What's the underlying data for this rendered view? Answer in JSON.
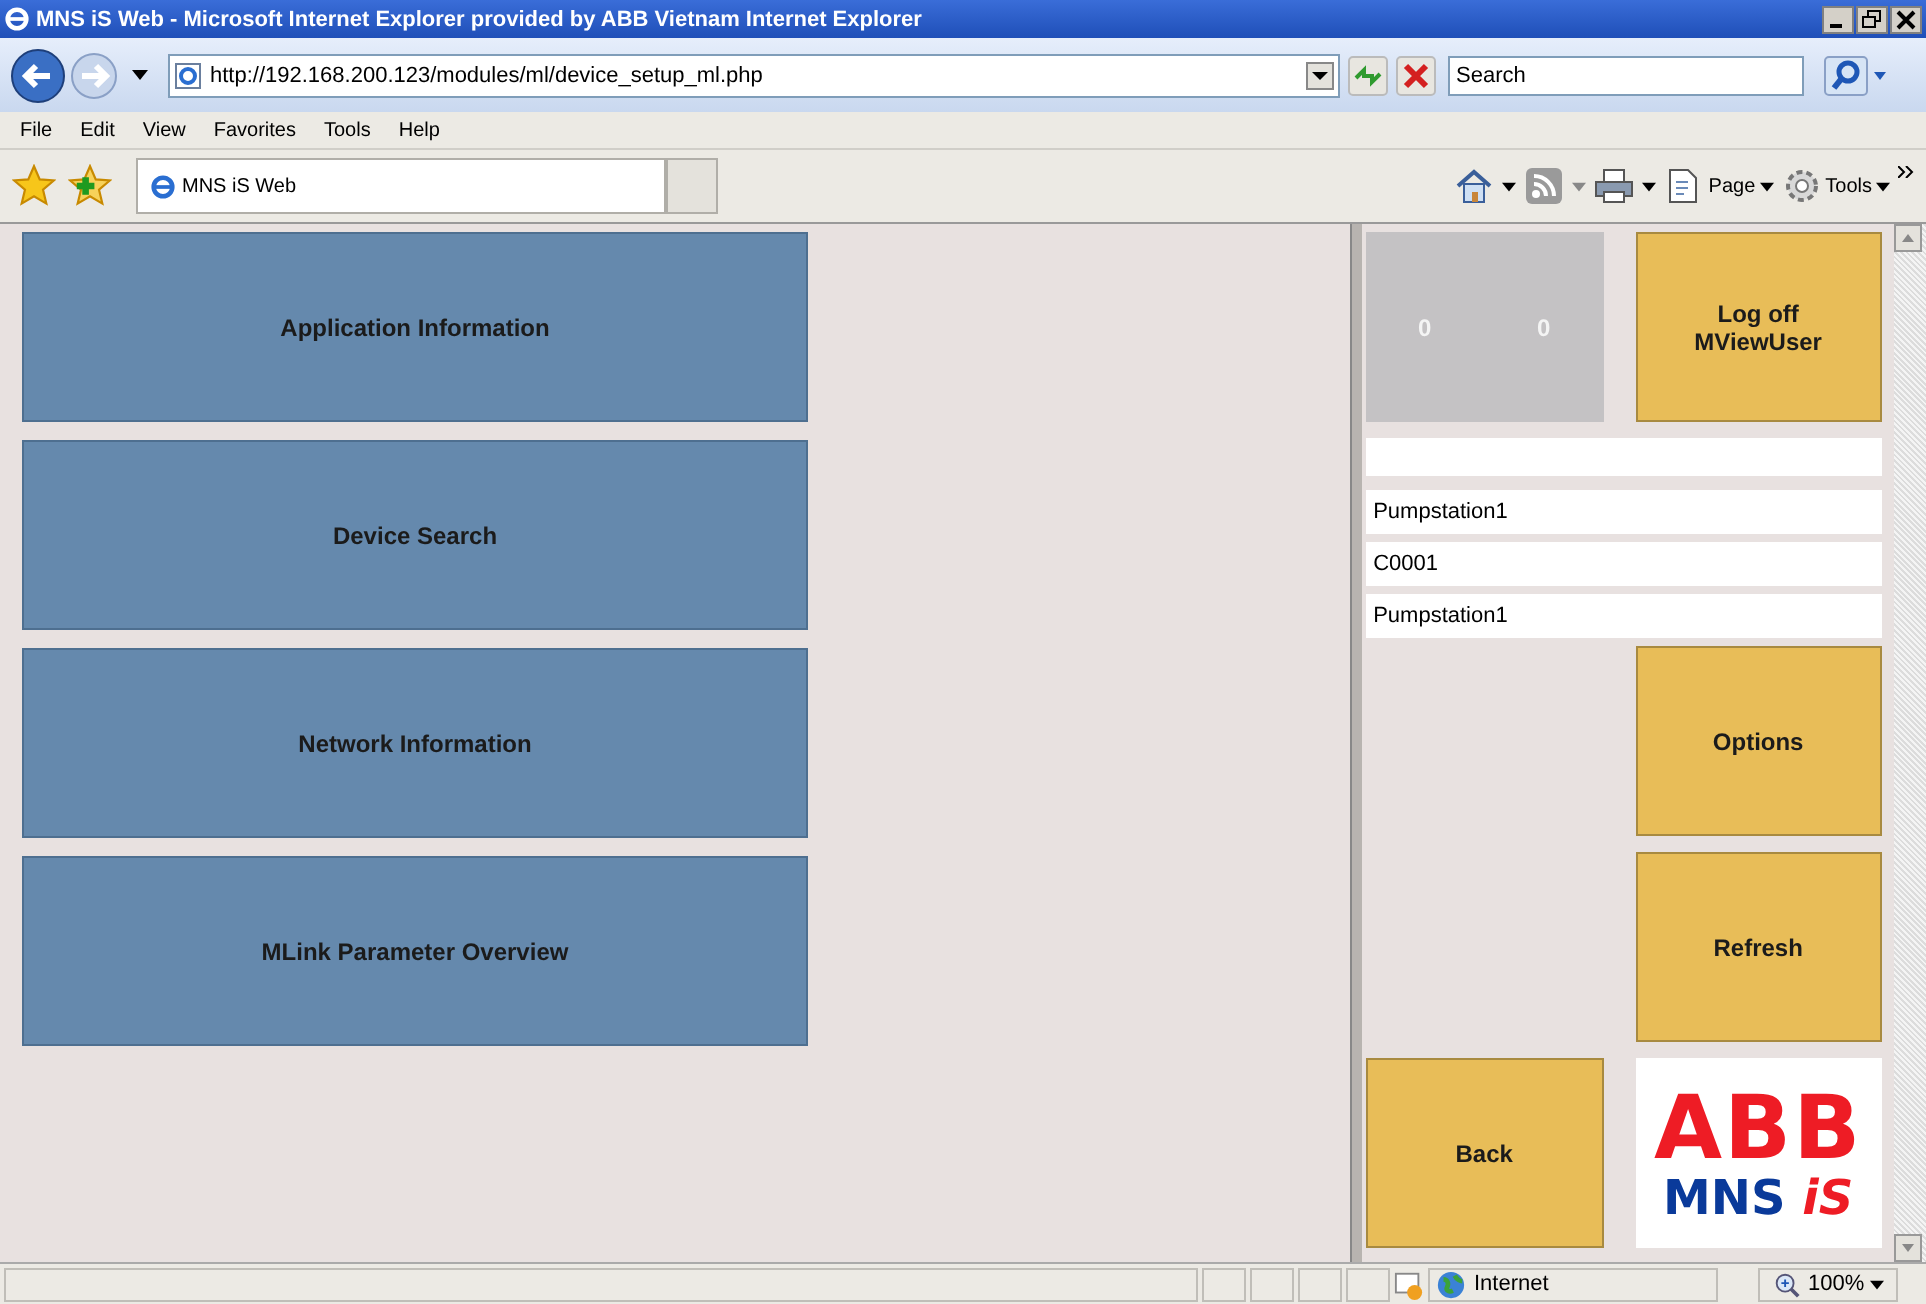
{
  "window": {
    "title": "MNS iS Web - Microsoft Internet Explorer provided by ABB Vietnam Internet Explorer"
  },
  "address_bar": {
    "url": "http://192.168.200.123/modules/ml/device_setup_ml.php"
  },
  "search": {
    "placeholder": "Search"
  },
  "menu": [
    "File",
    "Edit",
    "View",
    "Favorites",
    "Tools",
    "Help"
  ],
  "tab": {
    "title": "MNS iS Web"
  },
  "command_bar": {
    "page": "Page",
    "tools": "Tools"
  },
  "tiles": [
    {
      "label": "Application Information"
    },
    {
      "label": "Device Search"
    },
    {
      "label": "Network Information"
    },
    {
      "label": "MLink Parameter Overview"
    }
  ],
  "side_panel": {
    "counters": [
      "0",
      "0"
    ],
    "logoff_button": [
      "Log off",
      "MViewUser"
    ],
    "info_fields": [
      "Pumpstation1",
      "C0001",
      "Pumpstation1"
    ],
    "options_button": "Options",
    "refresh_button": "Refresh",
    "back_button": "Back",
    "logo": {
      "top": "ABB",
      "bottom": "MNS",
      "suffix": "iS"
    }
  },
  "status_bar": {
    "zone": "Internet",
    "zoom": "100%"
  }
}
